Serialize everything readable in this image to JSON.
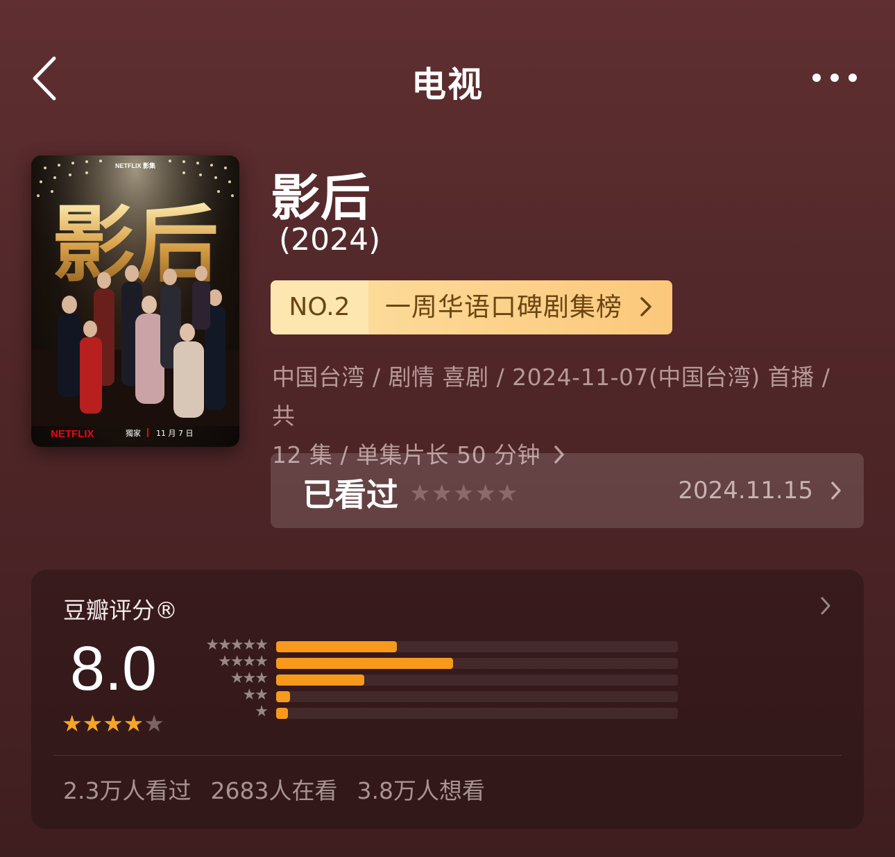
{
  "nav": {
    "title": "电视"
  },
  "poster": {
    "brand": "NETFLIX",
    "brand_tag": "影集",
    "title_text": "影后",
    "footer_exclusive": "獨家",
    "footer_date": "11 月 7 日"
  },
  "show": {
    "title": "影后",
    "year": "(2024)",
    "rank": {
      "no": "NO.2",
      "name": "一周华语口碑剧集榜"
    },
    "meta_line1": "中国台湾 / 剧情 喜剧 / 2024-11-07(中国台湾) 首播 / 共",
    "meta_line2": "12 集 / 单集片长 50 分钟"
  },
  "watched": {
    "label": "已看过",
    "stars": "★★★★★",
    "date": "2024.11.15"
  },
  "rating": {
    "title": "豆瓣评分®",
    "score": "8.0",
    "stars_filled": 4,
    "stars_total": 5,
    "distribution": [
      {
        "stars": "★★★★★",
        "fraction": 0.3
      },
      {
        "stars": "★★★★",
        "fraction": 0.44
      },
      {
        "stars": "★★★",
        "fraction": 0.22
      },
      {
        "stars": "★★",
        "fraction": 0.035
      },
      {
        "stars": "★",
        "fraction": 0.03
      }
    ],
    "stats": [
      "2.3万人看过",
      "2683人在看",
      "3.8万人想看"
    ]
  },
  "colors": {
    "accent_orange": "#f79a1c",
    "badge_gold": "#fbc87b",
    "badge_text": "#6b4512"
  }
}
